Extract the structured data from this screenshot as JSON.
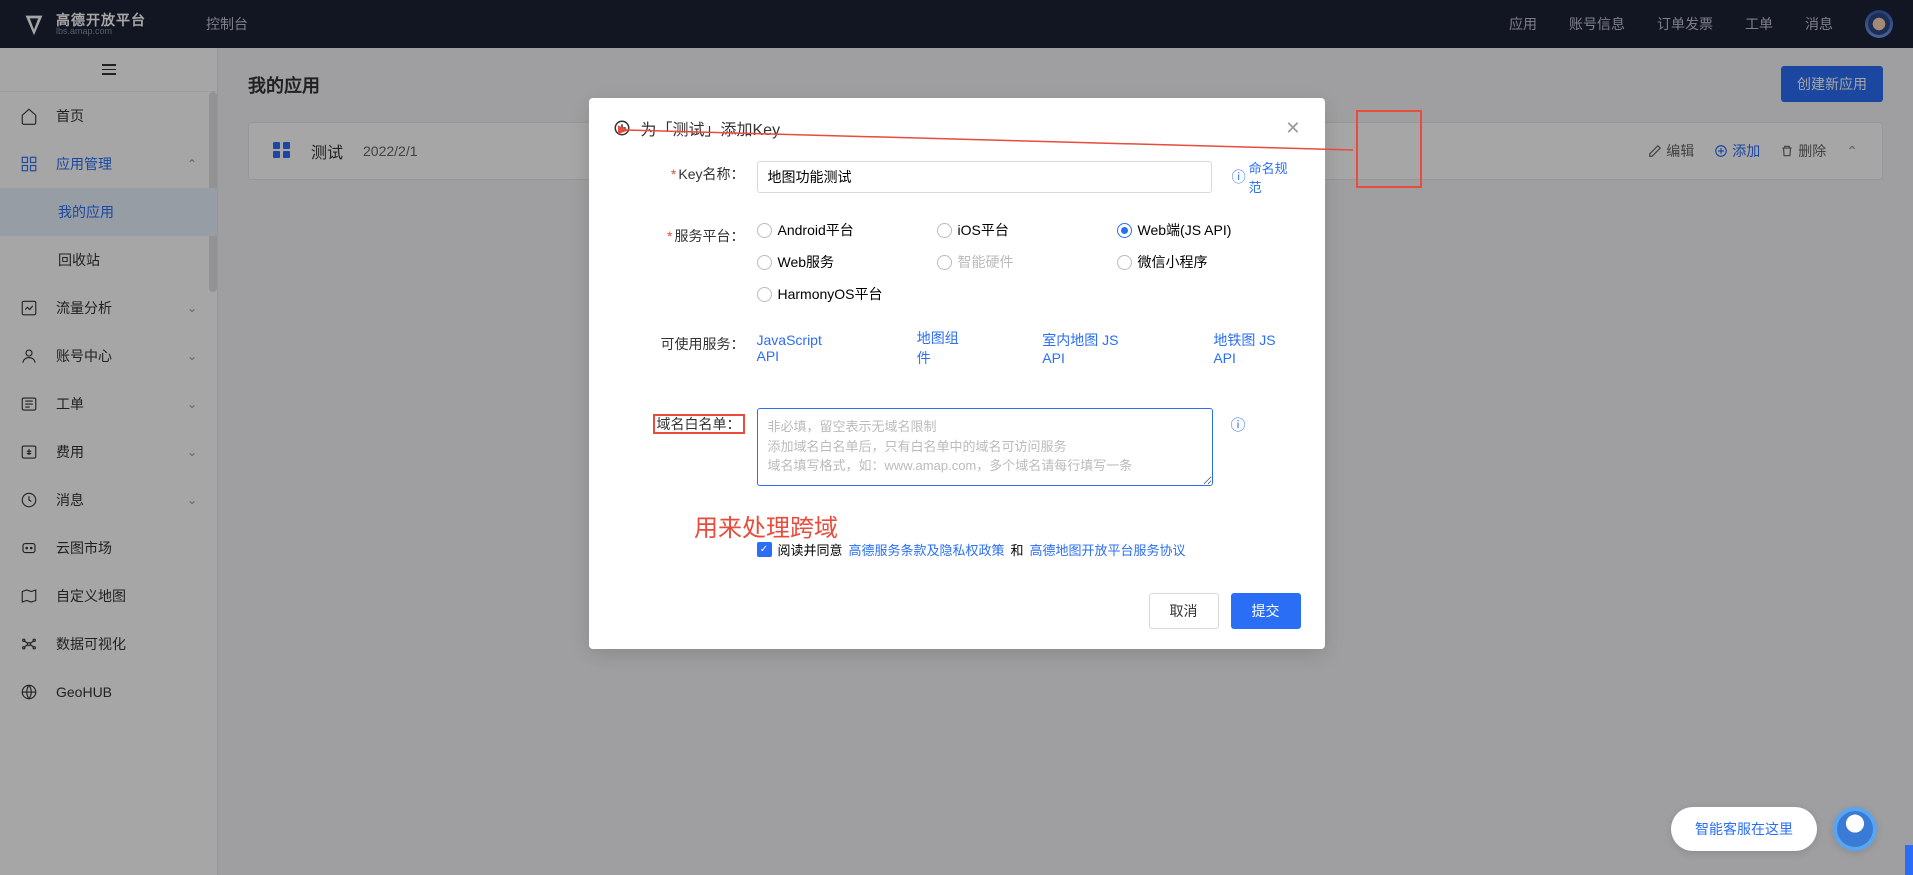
{
  "header": {
    "logo_main": "高德开放平台",
    "logo_sub": "lbs.amap.com",
    "console": "控制台",
    "nav": [
      "应用",
      "账号信息",
      "订单发票",
      "工单",
      "消息"
    ]
  },
  "sidebar": {
    "items": [
      {
        "label": "首页",
        "icon": "home"
      },
      {
        "label": "应用管理",
        "icon": "grid",
        "expanded": true,
        "selected": true,
        "children": [
          {
            "label": "我的应用",
            "active": true
          },
          {
            "label": "回收站"
          }
        ]
      },
      {
        "label": "流量分析",
        "icon": "chart",
        "chevron": true
      },
      {
        "label": "账号中心",
        "icon": "account",
        "chevron": true
      },
      {
        "label": "工单",
        "icon": "ticket",
        "chevron": true
      },
      {
        "label": "费用",
        "icon": "fee",
        "chevron": true
      },
      {
        "label": "消息",
        "icon": "msg",
        "chevron": true
      },
      {
        "label": "云图市场",
        "icon": "cloud"
      },
      {
        "label": "自定义地图",
        "icon": "custom-map"
      },
      {
        "label": "数据可视化",
        "icon": "visual"
      },
      {
        "label": "GeoHUB",
        "icon": "geohub"
      }
    ]
  },
  "page": {
    "title": "我的应用",
    "create_btn": "创建新应用"
  },
  "app_card": {
    "name": "测试",
    "date": "2022/2/1",
    "actions": {
      "edit": "编辑",
      "add": "添加",
      "delete": "删除"
    }
  },
  "modal": {
    "title": "为「测试」添加Key",
    "fields": {
      "key_name_label": "Key名称：",
      "key_name_value": "地图功能测试",
      "naming_link": "命名规范",
      "platform_label": "服务平台：",
      "platforms": [
        {
          "label": "Android平台"
        },
        {
          "label": "iOS平台"
        },
        {
          "label": "Web端(JS API)",
          "checked": true
        },
        {
          "label": "Web服务"
        },
        {
          "label": "智能硬件",
          "disabled": true
        },
        {
          "label": "微信小程序"
        },
        {
          "label": "HarmonyOS平台"
        }
      ],
      "services_label": "可使用服务：",
      "services": [
        "JavaScript API",
        "地图组件",
        "室内地图 JS API",
        "地铁图 JS API"
      ],
      "whitelist_label": "域名白名单：",
      "whitelist_placeholder": "非必填，留空表示无域名限制\n添加域名白名单后，只有白名单中的域名可访问服务\n域名填写格式，如：www.amap.com，多个域名请每行填写一条",
      "agree_prefix": "阅读并同意",
      "agree_link1": "高德服务条款及隐私权政策",
      "agree_and": "和",
      "agree_link2": "高德地图开放平台服务协议"
    },
    "buttons": {
      "cancel": "取消",
      "submit": "提交"
    }
  },
  "annotations": {
    "cross_origin": "用来处理跨域"
  },
  "support": {
    "text": "智能客服在这里"
  }
}
